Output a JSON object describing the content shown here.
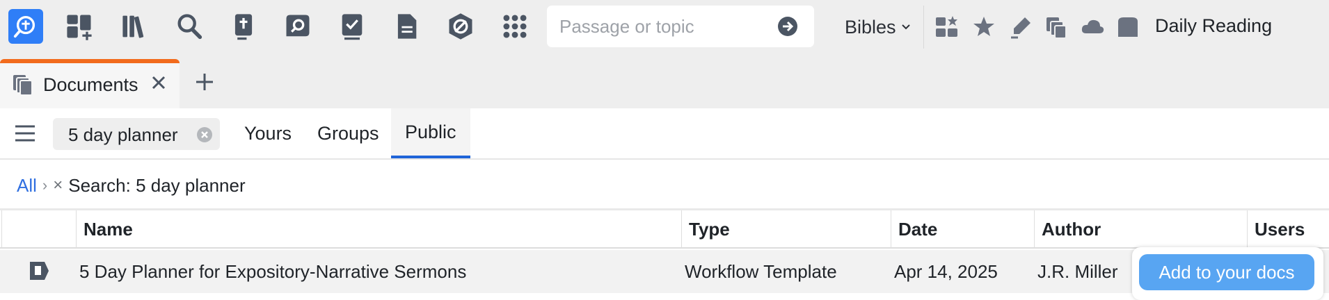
{
  "toolbar": {
    "icons": [
      "home-icon",
      "dashboard-icon",
      "library-icon",
      "search-icon",
      "guides-icon",
      "factbook-icon",
      "workflows-icon",
      "documents-icon",
      "atlas-icon",
      "apps-icon"
    ],
    "search": {
      "placeholder": "Passage or topic",
      "value": ""
    },
    "bibles_label": "Bibles",
    "right_icons": [
      "layouts-icon",
      "favorites-icon",
      "highlighter-icon",
      "copy-icon",
      "sync-cloud-icon",
      "reading-plan-icon"
    ],
    "daily_reading_label": "Daily Reading"
  },
  "tabs": {
    "active": {
      "label": "Documents",
      "icon": "documents-icon"
    }
  },
  "filter": {
    "search_chip": "5 day planner",
    "tabs": [
      {
        "label": "Yours"
      },
      {
        "label": "Groups"
      },
      {
        "label": "Public"
      }
    ],
    "active_tab": "Public"
  },
  "breadcrumb": {
    "all": "All",
    "separator": "›",
    "remove": "×",
    "current": "Search: 5 day planner"
  },
  "table": {
    "columns": [
      "Name",
      "Type",
      "Date",
      "Author",
      "Users"
    ],
    "rows": [
      {
        "icon": "workflow-template-icon",
        "name": "5 Day Planner for Expository-Narrative Sermons",
        "type": "Workflow Template",
        "date": "Apr 14, 2025",
        "author": "J.R. Miller"
      }
    ],
    "row_action": "Add to your docs"
  },
  "colors": {
    "accent_blue": "#2f7ef7",
    "tab_accent": "#f26b1d",
    "active_underline": "#1f64d8",
    "add_button": "#58a5f2",
    "icon_gray": "#4b5563"
  }
}
